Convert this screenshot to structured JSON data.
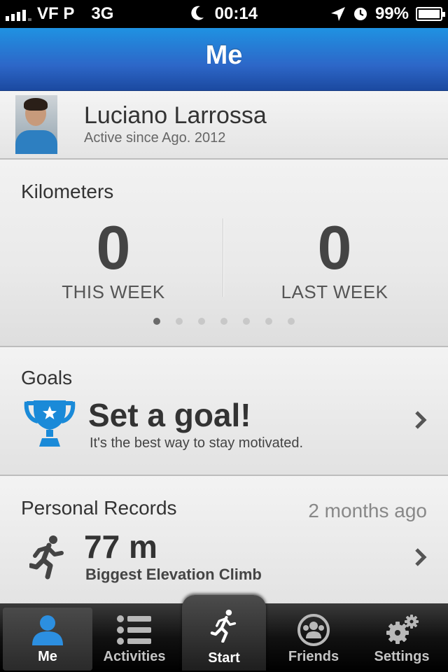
{
  "status_bar": {
    "carrier": "VF P",
    "network": "3G",
    "time": "00:14",
    "battery": "99%"
  },
  "nav": {
    "title": "Me"
  },
  "profile": {
    "name": "Luciano Larrossa",
    "since": "Active since Ago. 2012"
  },
  "kilometers": {
    "title": "Kilometers",
    "this_week": {
      "value": "0",
      "label": "THIS WEEK"
    },
    "last_week": {
      "value": "0",
      "label": "LAST WEEK"
    },
    "pages": 7,
    "current_page": 1
  },
  "goals": {
    "title": "Goals",
    "headline": "Set a goal!",
    "description": "It's the best way to stay motivated.",
    "icon": "trophy-icon",
    "icon_color": "#1a8ad8"
  },
  "records": {
    "title": "Personal Records",
    "ago": "2 months ago",
    "value": "77 m",
    "label": "Biggest Elevation Climb",
    "icon": "runner-icon"
  },
  "tabs": [
    {
      "label": "Me",
      "icon": "person-icon",
      "active": true
    },
    {
      "label": "Activities",
      "icon": "list-icon",
      "active": false
    },
    {
      "label": "Start",
      "icon": "runner-icon",
      "active": false
    },
    {
      "label": "Friends",
      "icon": "friends-icon",
      "active": false
    },
    {
      "label": "Settings",
      "icon": "gears-icon",
      "active": false
    }
  ]
}
